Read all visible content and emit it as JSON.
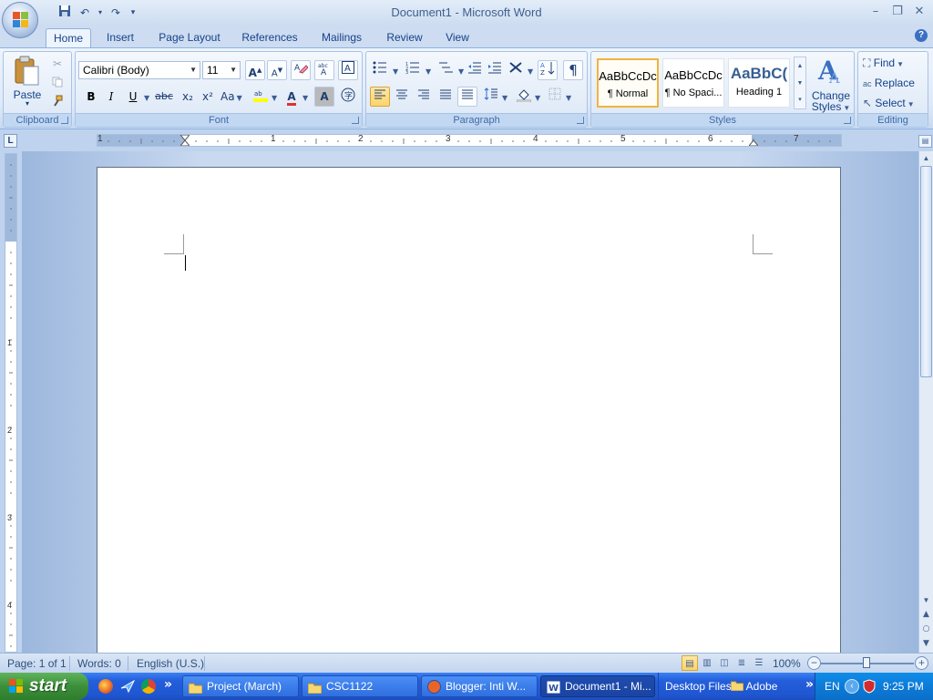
{
  "window": {
    "title": "Document1 - Microsoft Word"
  },
  "quick_access": {
    "icons": [
      "save-icon",
      "undo-icon",
      "redo-icon",
      "customize-qat-icon"
    ]
  },
  "tabs": [
    {
      "label": "Home",
      "active": true
    },
    {
      "label": "Insert"
    },
    {
      "label": "Page Layout"
    },
    {
      "label": "References"
    },
    {
      "label": "Mailings"
    },
    {
      "label": "Review"
    },
    {
      "label": "View"
    }
  ],
  "ribbon": {
    "clipboard": {
      "label": "Clipboard",
      "paste_label": "Paste"
    },
    "font": {
      "label": "Font",
      "font_name": "Calibri (Body)",
      "font_size": "11",
      "buttons": {
        "bold": "B",
        "italic": "I",
        "underline": "U",
        "strike": "abc",
        "subscript": "x₂",
        "superscript": "x²",
        "change_case": "Aa",
        "grow": "A",
        "shrink": "A",
        "font_color": "A",
        "char_shading": "A"
      }
    },
    "paragraph": {
      "label": "Paragraph",
      "show_marks": "¶"
    },
    "styles": {
      "label": "Styles",
      "items": [
        {
          "sample": "AaBbCcDc",
          "name": "¶ Normal",
          "active": true
        },
        {
          "sample": "AaBbCcDc",
          "name": "¶ No Spaci..."
        },
        {
          "sample": "AaBbC(",
          "name": "Heading 1"
        }
      ],
      "change_styles_line1": "Change",
      "change_styles_line2": "Styles"
    },
    "editing": {
      "label": "Editing",
      "find": "Find",
      "replace": "Replace",
      "select": "Select"
    }
  },
  "ruler": {
    "h_numbers": [
      "1",
      "1",
      "2",
      "3",
      "4",
      "5",
      "6",
      "7"
    ],
    "v_numbers": [
      "1",
      "2",
      "3",
      "4"
    ]
  },
  "statusbar": {
    "page": "Page: 1 of 1",
    "words": "Words: 0",
    "language": "English (U.S.)",
    "zoom": "100%"
  },
  "taskbar": {
    "start_label": "start",
    "tasks": [
      {
        "label": "Project (March)",
        "icon": "folder-icon"
      },
      {
        "label": "CSC1122",
        "icon": "folder-icon"
      },
      {
        "label": "Blogger: Inti W...",
        "icon": "firefox-icon"
      },
      {
        "label": "Document1 - Mi...",
        "icon": "word-icon",
        "active": true
      }
    ],
    "toolbars": [
      "Desktop Files",
      "Adobe"
    ],
    "language": "EN",
    "time": "9:25 PM"
  },
  "colors": {
    "ribbon_bg": "#dfe9f7",
    "taskbar_blue": "#245edb",
    "start_green": "#3c8f3a",
    "selected_gold": "#fbd46a"
  }
}
